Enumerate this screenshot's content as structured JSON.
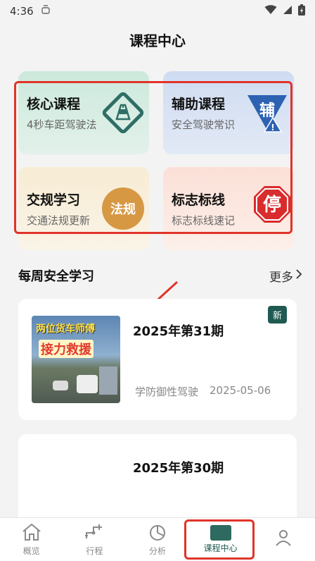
{
  "status_bar": {
    "time": "4:36",
    "notif_icon": "robot-icon"
  },
  "header": {
    "title": "课程中心"
  },
  "cards": [
    {
      "title": "核心课程",
      "subtitle": "4秒车距驾驶法",
      "icon": "road-diamond-icon",
      "icon_color": "#2f6e66"
    },
    {
      "title": "辅助课程",
      "subtitle": "安全驾驶常识",
      "icon": "fu-sign-icon",
      "icon_text": "辅",
      "icon_color": "#2d62b3"
    },
    {
      "title": "交规学习",
      "subtitle": "交通法规更新",
      "icon": "law-badge-icon",
      "icon_text": "法规",
      "icon_color": "#d79843"
    },
    {
      "title": "标志标线",
      "subtitle": "标志标线速记",
      "icon": "stop-sign-icon",
      "icon_text": "停",
      "icon_color": "#d92c2c"
    }
  ],
  "weekly": {
    "title": "每周安全学习",
    "more": "更多"
  },
  "issues": [
    {
      "title": "2025年第31期",
      "badge": "新",
      "category": "学防御性驾驶",
      "date": "2025-05-06",
      "thumb_line1": "两位货车师傅",
      "thumb_line2": "接力救援"
    },
    {
      "title": "2025年第30期"
    }
  ],
  "tabs": [
    {
      "label": "概览",
      "icon": "home-icon"
    },
    {
      "label": "行程",
      "icon": "route-icon"
    },
    {
      "label": "分析",
      "icon": "pie-chart-icon"
    },
    {
      "label": "课程中心",
      "icon": "course-icon"
    },
    {
      "label": "",
      "icon": "user-icon"
    }
  ],
  "colors": {
    "accent": "#1f5a52",
    "highlight": "#e0342a"
  }
}
